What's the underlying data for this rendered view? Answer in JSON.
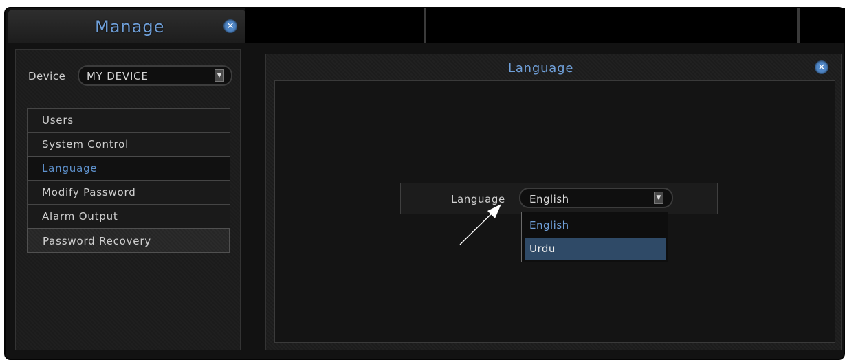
{
  "window": {
    "title": "Manage"
  },
  "device": {
    "label": "Device",
    "selected": "MY DEVICE"
  },
  "sidebar": {
    "items": [
      {
        "label": "Users"
      },
      {
        "label": "System Control"
      },
      {
        "label": "Language"
      },
      {
        "label": "Modify Password"
      },
      {
        "label": "Alarm Output"
      },
      {
        "label": "Password Recovery"
      }
    ],
    "active": "Language"
  },
  "panel": {
    "title": "Language",
    "field_label": "Language",
    "selected": "English",
    "options": [
      "English",
      "Urdu"
    ],
    "highlighted_option": "Urdu"
  },
  "colors": {
    "accent": "#6f9fd8",
    "close": "#4f86c6",
    "highlight": "#2f4a67"
  },
  "icons": {
    "close": "close-icon",
    "dropdown": "dropdown-arrow-icon"
  }
}
